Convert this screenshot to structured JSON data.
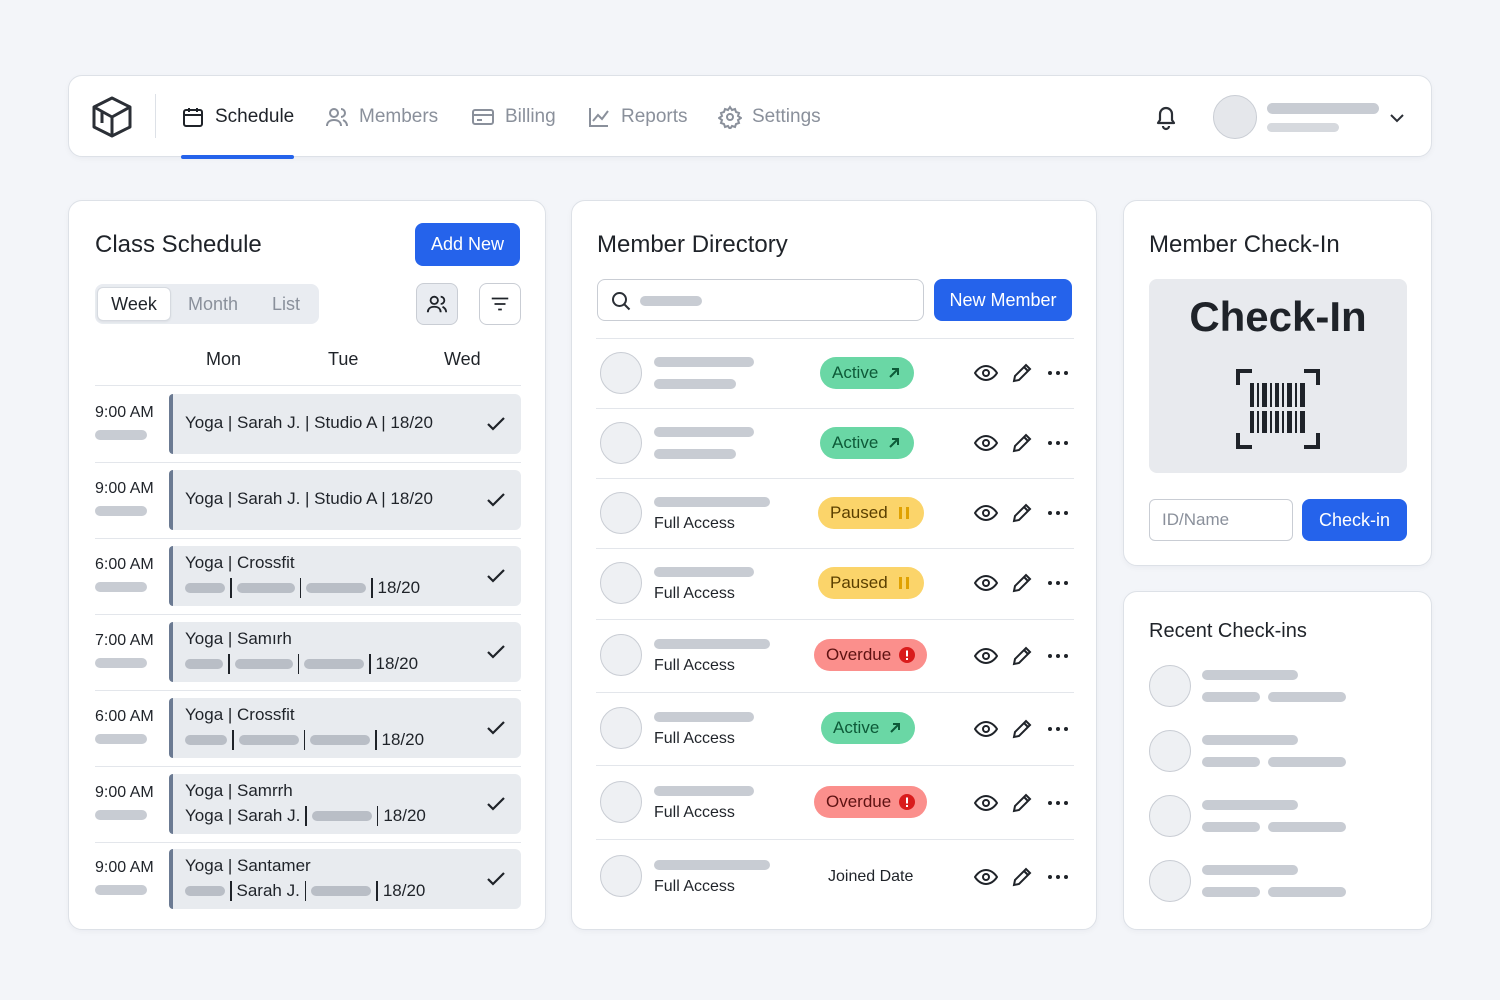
{
  "nav": {
    "items": [
      {
        "label": "Schedule",
        "icon": "calendar-icon",
        "active": true
      },
      {
        "label": "Members",
        "icon": "users-icon",
        "active": false
      },
      {
        "label": "Billing",
        "icon": "credit-card-icon",
        "active": false
      },
      {
        "label": "Reports",
        "icon": "chart-line-icon",
        "active": false
      },
      {
        "label": "Settings",
        "icon": "gear-icon",
        "active": false
      }
    ]
  },
  "schedule": {
    "title": "Class Schedule",
    "add_label": "Add New",
    "views": [
      "Week",
      "Month",
      "List"
    ],
    "days": [
      "Mon",
      "Tue",
      "Wed"
    ],
    "rows": [
      {
        "time": "9:00 AM",
        "line1": "Yoga | Sarah J. | Studio A | 18/20"
      },
      {
        "time": "9:00 AM",
        "line1": "Yoga | Sarah J. | Studio A | 18/20"
      },
      {
        "time": "6:00 AM",
        "line1": "Yoga | Crossfit",
        "line2": "18/20"
      },
      {
        "time": "7:00 AM",
        "line1": "Yoga | Samırh",
        "line2": "18/20"
      },
      {
        "time": "6:00 AM",
        "line1": "Yoga | Crossfit",
        "line2": "18/20"
      },
      {
        "time": "9:00 AM",
        "line1": "Yoga | Samrrh",
        "line2a": "Yoga | Sarah J.",
        "line2": "18/20"
      },
      {
        "time": "9:00 AM",
        "line1": "Yoga | Santamer",
        "line2a": "Sarah J.",
        "line2": "18/20"
      }
    ]
  },
  "directory": {
    "title": "Member Directory",
    "new_label": "New Member",
    "rows": [
      {
        "sub": "",
        "status": "Active"
      },
      {
        "sub": "",
        "status": "Active"
      },
      {
        "sub": "Full Access",
        "status": "Paused"
      },
      {
        "sub": "Full Access",
        "status": "Paused"
      },
      {
        "sub": "Full Access",
        "status": "Overdue"
      },
      {
        "sub": "Full Access",
        "status": "Active"
      },
      {
        "sub": "Full Access",
        "status": "Overdue"
      },
      {
        "sub": "Full Access",
        "status": "Joined Date"
      }
    ]
  },
  "checkin": {
    "title": "Member Check-In",
    "scan_label": "Check-In",
    "placeholder": "ID/Name",
    "button_label": "Check-in"
  },
  "recent": {
    "title": "Recent Check-ins"
  },
  "colors": {
    "accent": "#2563eb",
    "active": "#6ad7a5",
    "paused": "#fbd46a",
    "overdue": "#fb8f8c"
  }
}
